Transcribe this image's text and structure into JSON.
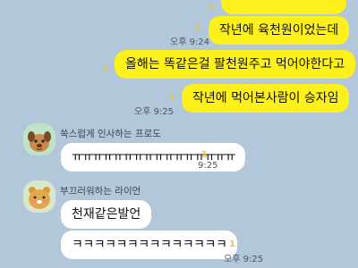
{
  "messages": [
    {
      "id": "m0",
      "side": "me",
      "text": "",
      "read": "1"
    },
    {
      "id": "m1",
      "side": "me",
      "text": "작년에 육천원이었는데",
      "read": "1",
      "time": "오후 9:24"
    },
    {
      "id": "m2",
      "side": "me",
      "text": "올해는 똑같은걸 팔천원주고 먹어야한다고",
      "read": "1"
    },
    {
      "id": "m3",
      "side": "me",
      "text": "작년에 먹어본사람이 승자임",
      "read": "1",
      "time": "오후 9:25"
    },
    {
      "id": "m4",
      "side": "peer",
      "sender": "쑥스럽게 인사하는 프로도",
      "avatar_icon": "frodo-dog-avatar",
      "text": "ㅠㅠㅠㅠㅠㅠㅠㅠㅠㅠㅠㅠㅠㅠㅠㅠ",
      "read": "1",
      "time": "9:25"
    },
    {
      "id": "m5",
      "side": "peer",
      "sender": "부끄러워하는 라이언",
      "avatar_icon": "ryan-lion-avatar",
      "text": "천재같은발언"
    },
    {
      "id": "m6",
      "side": "peer",
      "text": "ㅋㅋㅋㅋㅋㅋㅋㅋㅋㅋㅋㅋㅋㅋ",
      "read": "1",
      "time": "오후 9:25"
    }
  ],
  "colors": {
    "background": "#b2c7d9",
    "my_bubble": "#fef01b",
    "peer_bubble": "#ffffff",
    "read_count": "#e8c93a"
  }
}
